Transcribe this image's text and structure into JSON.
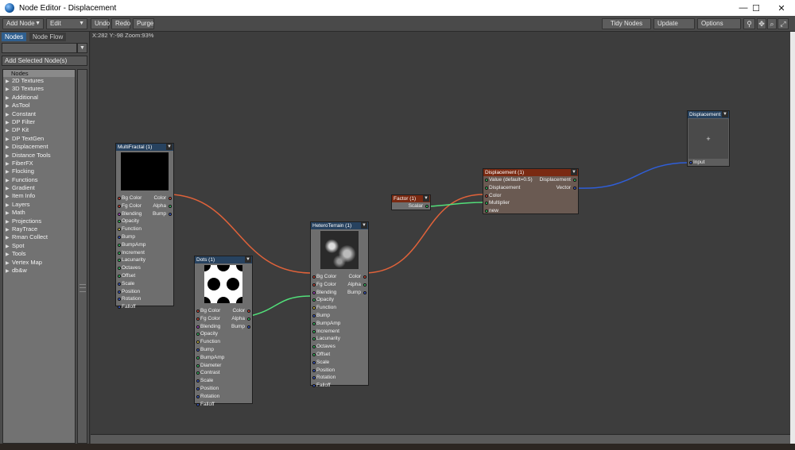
{
  "window": {
    "title": "Node Editor - Displacement",
    "minimize": "—",
    "maximize": "☐",
    "close": "✕"
  },
  "toolbar": {
    "add_node": "Add Node",
    "edit": "Edit",
    "undo": "Undo",
    "redo": "Redo",
    "purge": "Purge",
    "tidy_nodes": "Tidy Nodes",
    "update": "Update",
    "options": "Options"
  },
  "left_panel": {
    "tabs": [
      "Nodes",
      "Node Flow"
    ],
    "add_selected": "Add Selected Node(s)",
    "list_header": "Nodes",
    "categories": [
      "2D Textures",
      "3D Textures",
      "Additional",
      "AsTool",
      "Constant",
      "DP Filter",
      "DP Kit",
      "DP TextGen",
      "Displacement",
      "Distance Tools",
      "FiberFX",
      "Flocking",
      "Functions",
      "Gradient",
      "Item Info",
      "Layers",
      "Math",
      "Projections",
      "RayTrace",
      "Rman Collect",
      "Spot",
      "Tools",
      "Vertex Map",
      "db&w"
    ]
  },
  "canvas": {
    "coords": "X:282 Y:-98 Zoom:93%"
  },
  "nodes": {
    "multifractal": {
      "title": "MultiFractal (1)",
      "inputs": [
        "Bg Color",
        "Fg Color",
        "Blending",
        "Opacity",
        "Function",
        "Bump",
        "BumpAmp",
        "Increment",
        "Lacunarity",
        "Octaves",
        "Offset",
        "Scale",
        "Position",
        "Rotation",
        "Falloff"
      ],
      "outputs": [
        "Color",
        "Alpha",
        "Bump"
      ]
    },
    "dots": {
      "title": "Dots (1)",
      "inputs": [
        "Bg Color",
        "Fg Color",
        "Blending",
        "Opacity",
        "Function",
        "Bump",
        "BumpAmp",
        "Diameter",
        "Contrast",
        "Scale",
        "Position",
        "Rotation",
        "Falloff"
      ],
      "outputs": [
        "Color",
        "Alpha",
        "Bump"
      ]
    },
    "heteroterrain": {
      "title": "HeteroTerrain (1)",
      "inputs": [
        "Bg Color",
        "Fg Color",
        "Blending",
        "Opacity",
        "Function",
        "Bump",
        "BumpAmp",
        "Increment",
        "Lacunarity",
        "Octaves",
        "Offset",
        "Scale",
        "Position",
        "Rotation",
        "Falloff"
      ],
      "outputs": [
        "Color",
        "Alpha",
        "Bump"
      ]
    },
    "factor": {
      "title": "Factor (1)",
      "outputs": [
        "Scalar"
      ]
    },
    "displacement_mid": {
      "title": "Displacement (1)",
      "inputs": [
        "Value (default=0.5)",
        "Displacement",
        "Color",
        "Multiplier",
        "new"
      ],
      "outputs": [
        "Displacement",
        "Vector"
      ]
    },
    "displacement_out": {
      "title": "Displacement",
      "inputs": [
        "Input"
      ],
      "preview_symbol": "+"
    }
  },
  "colors": {
    "wire_color": "#e0623a",
    "wire_scalar": "#52e07a",
    "wire_vector": "#2f5ed8",
    "node_header_blue": "#27425f",
    "node_header_brown": "#7a2a12",
    "port_color": "#e04a3a",
    "port_scalar": "#39d16a",
    "port_vector": "#3f5fd8",
    "port_function": "#e8d24a"
  }
}
